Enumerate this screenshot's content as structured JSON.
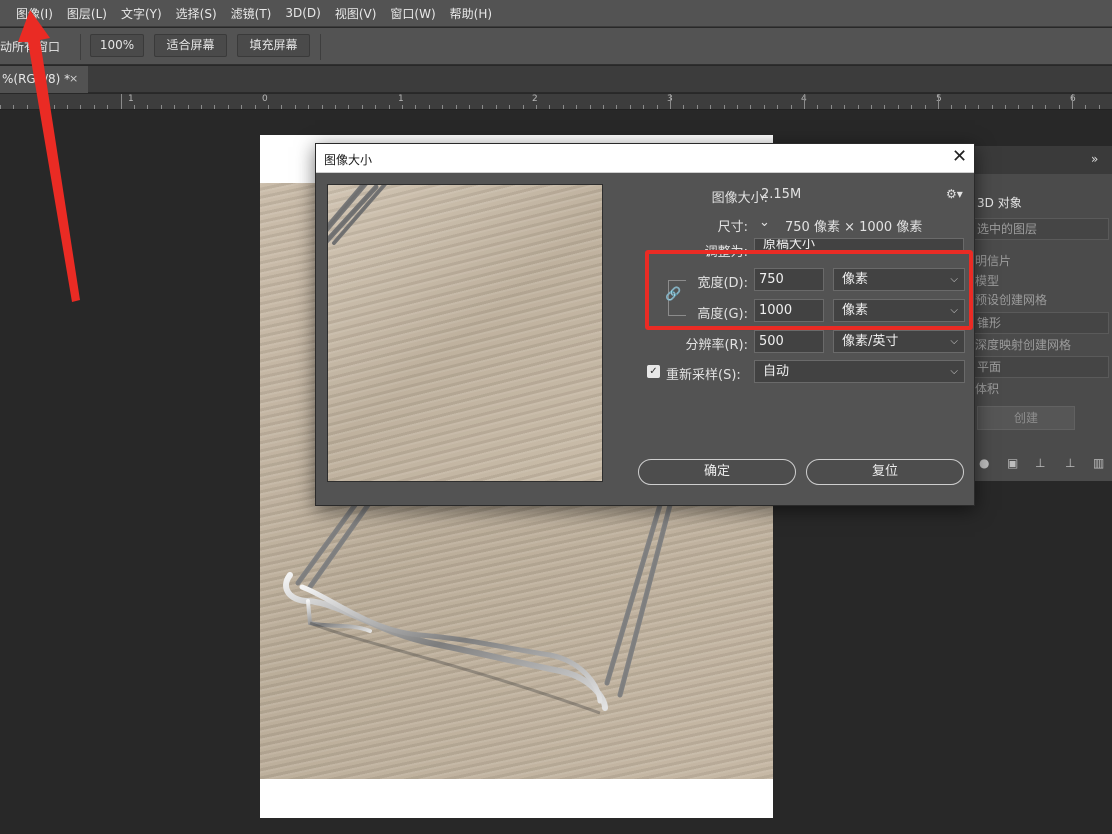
{
  "menubar": {
    "items": [
      "图像(I)",
      "图层(L)",
      "文字(Y)",
      "选择(S)",
      "滤镜(T)",
      "3D(D)",
      "视图(V)",
      "窗口(W)",
      "帮助(H)"
    ]
  },
  "optbar": {
    "label": "动所有窗口",
    "btn_100": "100%",
    "btn_fit": "适合屏幕",
    "btn_fill": "填充屏幕"
  },
  "tabs": {
    "doc_title": "%(RGB/8) *",
    "close": "×"
  },
  "ruler": {
    "numbers": [
      "1",
      "0",
      "1",
      "2",
      "3",
      "4",
      "5",
      "6"
    ]
  },
  "panel": {
    "collapse": "»",
    "title": "3D 对象",
    "select1": "选中的图层",
    "item1": "明信片",
    "item2": "模型",
    "item3": "预设创建网格",
    "select2": "锥形",
    "item4": "深度映射创建网格",
    "select3": "平面",
    "item5": "体积",
    "create": "创建",
    "icons": [
      "light-bulb-icon",
      "scene-icon",
      "ground-icon",
      "camera-icon",
      "trash-icon"
    ]
  },
  "dialog": {
    "title": "图像大小",
    "close": "✕",
    "image_size_label": "图像大小:",
    "image_size_value": "2.15M",
    "dims_label": "尺寸:",
    "dims_value": "750 像素 × 1000 像素",
    "fit_label": "调整为:",
    "fit_value": "原稿大小",
    "width_label": "宽度(D):",
    "width_value": "750",
    "width_unit": "像素",
    "height_label": "高度(G):",
    "height_value": "1000",
    "height_unit": "像素",
    "res_label": "分辨率(R):",
    "res_value": "500",
    "res_unit": "像素/英寸",
    "resample_label": "重新采样(S):",
    "resample_value": "自动",
    "ok": "确定",
    "reset": "复位"
  },
  "colors": {
    "annotation_red": "#ea2b24",
    "dialog_bg": "#535353",
    "app_bg": "#282828"
  }
}
